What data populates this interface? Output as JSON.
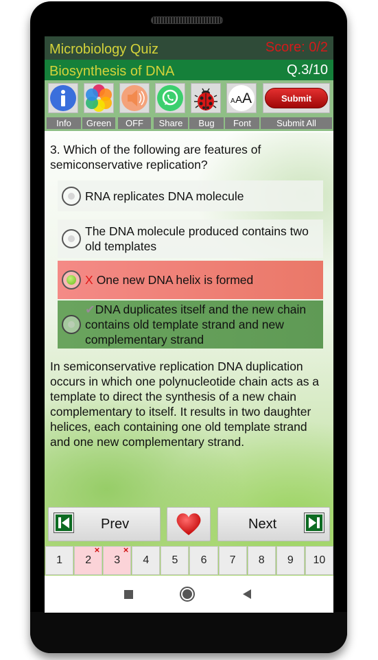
{
  "header": {
    "app_title": "Microbiology Quiz",
    "score": "Score: 0/2",
    "topic": "Biosynthesis of DNA",
    "question_counter": "Q.3/10"
  },
  "toolbar": {
    "items": [
      {
        "icon": "info-icon",
        "label": "Info"
      },
      {
        "icon": "color-theme-icon",
        "label": "Green"
      },
      {
        "icon": "speaker-icon",
        "label": "OFF"
      },
      {
        "icon": "whatsapp-share-icon",
        "label": "Share"
      },
      {
        "icon": "ladybug-icon",
        "label": "Bug"
      },
      {
        "icon": "font-size-icon",
        "label": "Font",
        "glyph": "AAA"
      },
      {
        "icon": "submit-button",
        "label": "Submit All",
        "button_text": "Submit"
      }
    ]
  },
  "question": {
    "text": "3. Which of the following are features of semiconservative replication?",
    "options": [
      {
        "text": "RNA replicates DNA molecule",
        "state": "unselected",
        "marker": ""
      },
      {
        "text": "The DNA molecule produced contains two old templates",
        "state": "unselected",
        "marker": ""
      },
      {
        "text": "One new DNA helix is formed",
        "state": "selected-wrong",
        "marker": "X"
      },
      {
        "text": "DNA duplicates itself and the new chain contains old template strand and new complementary strand",
        "state": "correct",
        "marker": "✔"
      }
    ]
  },
  "explanation": "In semiconservative replication DNA duplication occurs in which one polynucleotide chain acts as a template to direct the synthesis of a new chain complementary to itself. It results in two daughter helices, each containing one old template strand and one new complementary strand.",
  "navigation": {
    "prev_label": "Prev",
    "next_label": "Next",
    "favorite_icon": "heart-icon"
  },
  "pages": [
    {
      "label": "1",
      "status": "unanswered"
    },
    {
      "label": "2",
      "status": "wrong"
    },
    {
      "label": "3",
      "status": "wrong"
    },
    {
      "label": "4",
      "status": "unanswered"
    },
    {
      "label": "5",
      "status": "unanswered"
    },
    {
      "label": "6",
      "status": "unanswered"
    },
    {
      "label": "7",
      "status": "unanswered"
    },
    {
      "label": "8",
      "status": "unanswered"
    },
    {
      "label": "9",
      "status": "unanswered"
    },
    {
      "label": "10",
      "status": "unanswered"
    }
  ],
  "page_wrong_marker": "×",
  "colors": {
    "title_bar": "#2f4b38",
    "topic_bar": "#15803a",
    "title_text": "#d4d33a",
    "score_text": "#d41a1a",
    "wrong_option": "#f48a86",
    "correct_option": "#6aa45e"
  }
}
